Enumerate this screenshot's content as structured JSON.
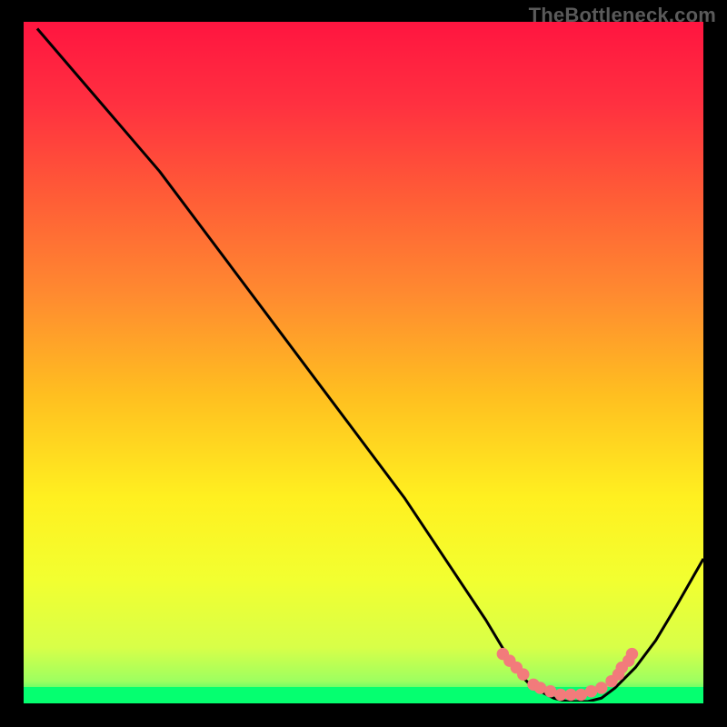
{
  "watermark": "TheBottleneck.com",
  "chart_data": {
    "type": "line",
    "title": "",
    "xlabel": "",
    "ylabel": "",
    "xlim": [
      0,
      100
    ],
    "ylim": [
      0,
      100
    ],
    "series": [
      {
        "name": "bottleneck-curve",
        "x": [
          2,
          8,
          14,
          20,
          26,
          32,
          38,
          44,
          50,
          56,
          60,
          64,
          68,
          71,
          73,
          75,
          78,
          80,
          83,
          85,
          87,
          90,
          93,
          96,
          100
        ],
        "y": [
          99,
          92,
          85,
          78,
          70,
          62,
          54,
          46,
          38,
          30,
          24,
          18,
          12,
          7,
          4,
          2,
          0.5,
          0,
          0,
          0.5,
          2,
          5,
          9,
          14,
          21
        ]
      }
    ],
    "markers": {
      "name": "valley-markers",
      "x": [
        70.5,
        71.5,
        72.5,
        73.5,
        75,
        76,
        77.5,
        79,
        80.5,
        82,
        83.5,
        85,
        86.5,
        87.5,
        88,
        89,
        89.5
      ],
      "y": [
        7,
        6,
        5,
        4,
        2.5,
        2,
        1.5,
        1,
        1,
        1,
        1.5,
        2,
        3,
        4,
        5,
        6,
        7
      ]
    },
    "gradient_stops": [
      {
        "offset": 0.0,
        "color": "#ff1540"
      },
      {
        "offset": 0.12,
        "color": "#ff3040"
      },
      {
        "offset": 0.25,
        "color": "#ff5a37"
      },
      {
        "offset": 0.4,
        "color": "#ff8a30"
      },
      {
        "offset": 0.55,
        "color": "#ffbf20"
      },
      {
        "offset": 0.7,
        "color": "#fff020"
      },
      {
        "offset": 0.82,
        "color": "#f2ff30"
      },
      {
        "offset": 0.92,
        "color": "#d8ff48"
      },
      {
        "offset": 0.97,
        "color": "#9dff60"
      },
      {
        "offset": 1.0,
        "color": "#05ff70"
      }
    ],
    "marker_color": "#f27b7b",
    "curve_color": "#000000"
  }
}
